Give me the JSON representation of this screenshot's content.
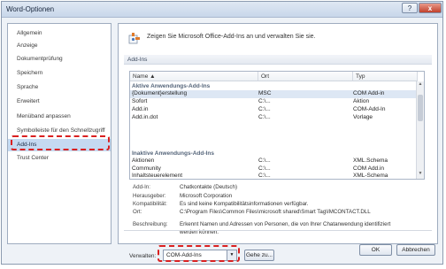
{
  "window": {
    "title": "Word-Optionen",
    "help": "?",
    "close": "x"
  },
  "sidebar": {
    "items": [
      {
        "label": "Allgemein"
      },
      {
        "label": "Anzeige"
      },
      {
        "label": "Dokumentprüfung"
      },
      {
        "label": "Speichern"
      },
      {
        "label": "Sprache"
      },
      {
        "label": "Erweitert"
      },
      {
        "label": "Menüband anpassen"
      },
      {
        "label": "Symbolleiste für den Schnellzugriff"
      },
      {
        "label": "Add-Ins",
        "selected": true
      },
      {
        "label": "Trust Center"
      }
    ]
  },
  "main": {
    "heading": "Zeigen Sie Microsoft Office-Add-Ins an und verwalten Sie sie.",
    "section_title": "Add-Ins",
    "table": {
      "headers": [
        "Name ▲",
        "Ort",
        "Typ"
      ],
      "groups": [
        {
          "title": "Aktive Anwendungs-Add-Ins",
          "rows": [
            {
              "name": "{Dokument}erstellung",
              "location": "MSC",
              "type": "COM Add-in",
              "selected": true
            },
            {
              "name": "Sofort",
              "location": "C:\\...",
              "type": "Aktion"
            },
            {
              "name": "Add.in",
              "location": "C:\\...",
              "type": "COM-Add-In"
            },
            {
              "name": "Add.in.dot",
              "location": "C:\\...",
              "type": "Vorlage"
            }
          ]
        },
        {
          "title": "Inaktive Anwendungs-Add-Ins",
          "rows": [
            {
              "name": "Aktionen",
              "location": "C:\\...",
              "type": "XML.Schema"
            },
            {
              "name": "Community",
              "location": "C:\\...",
              "type": "COM Add.in"
            },
            {
              "name": "Inhaltsteuerelement",
              "location": "C:\\...",
              "type": "XML-Schema"
            }
          ]
        }
      ]
    },
    "details": {
      "addin_label": "Add-In:",
      "addin_value": "Chatkontakte (Deutsch)",
      "publisher_label": "Herausgeber:",
      "publisher_value": "Microsoft Corporation",
      "compat_label": "Kompatibilität:",
      "compat_value": "Es sind keine Kompatibilitätsinformationen verfügbar.",
      "location_label": "Ort:",
      "location_value": "C:\\Program Files\\Common Files\\microsoft shared\\Smart Tag\\IMCONTACT.DLL",
      "desc_label": "Beschreibung:",
      "desc_line1": "Erkennt Namen und Adressen von Personen, die von Ihrer Chatanwendung identifiziert",
      "desc_line2": "werden können."
    },
    "manage": {
      "label": "Verwalten:",
      "selected": "COM-Add-Ins",
      "go_label": "Gehe zu..."
    }
  },
  "footer": {
    "ok_label": "OK",
    "cancel_label": "Abbrechen"
  },
  "colors": {
    "highlight": "#d92020",
    "selection": "#c5d9f1"
  },
  "icons": [
    "help-icon",
    "close-icon",
    "addins-plug-icon",
    "sort-arrow-icon",
    "dropdown-arrow-icon"
  ]
}
